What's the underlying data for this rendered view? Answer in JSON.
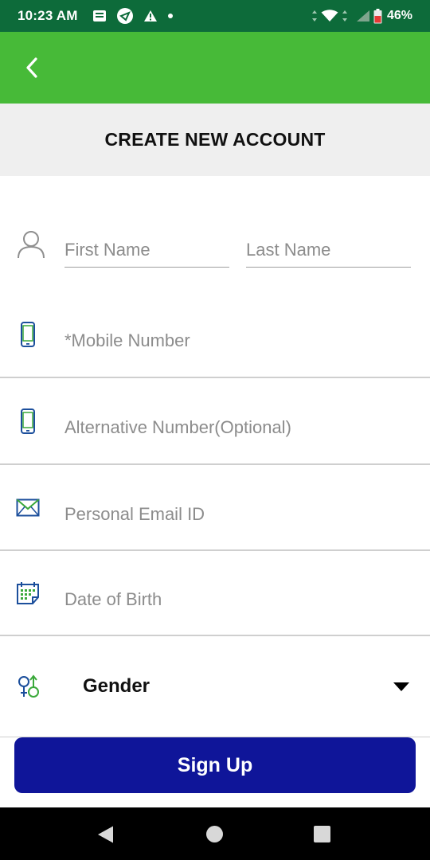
{
  "status_bar": {
    "time": "10:23 AM",
    "battery": "46%",
    "icons": [
      "notes-icon",
      "app-icon",
      "warning-icon",
      "dot-icon",
      "data-arrows-icon",
      "wifi-icon",
      "signal-icon",
      "battery-icon"
    ]
  },
  "app_bar": {
    "back_icon": "chevron-left-icon"
  },
  "page": {
    "title": "CREATE NEW ACCOUNT"
  },
  "form": {
    "first_name": {
      "placeholder": "First Name",
      "value": ""
    },
    "last_name": {
      "placeholder": "Last Name",
      "value": ""
    },
    "mobile": {
      "placeholder": "*Mobile Number",
      "value": ""
    },
    "alternative": {
      "placeholder": "Alternative Number(Optional)",
      "value": ""
    },
    "email": {
      "placeholder": "Personal Email ID",
      "value": ""
    },
    "dob": {
      "placeholder": "Date of Birth",
      "value": ""
    },
    "gender": {
      "label": "Gender"
    },
    "signup_label": "Sign Up"
  },
  "colors": {
    "status_bar": "#0d6b3a",
    "app_bar": "#47ba38",
    "title_band": "#efefef",
    "primary_button": "#0f1599",
    "icon_blue": "#1c4f9c",
    "icon_green": "#3aa93a"
  },
  "nav_bar": {
    "icons": [
      "back-triangle-icon",
      "home-circle-icon",
      "recents-square-icon"
    ]
  }
}
